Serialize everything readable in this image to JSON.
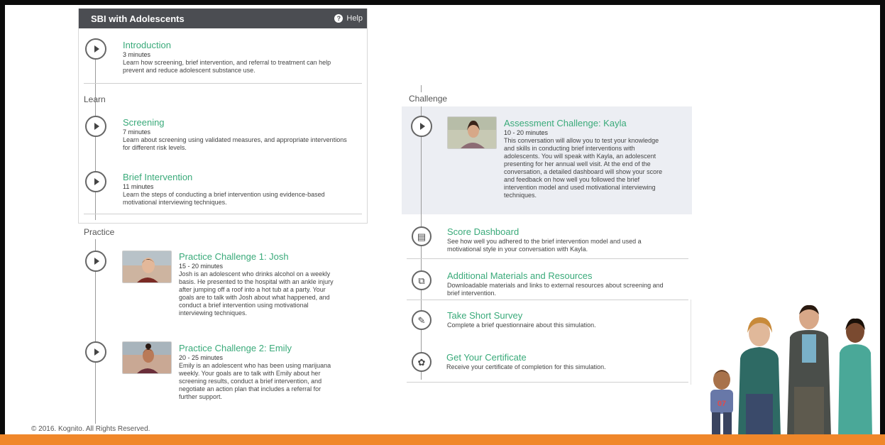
{
  "header": {
    "title": "SBI with Adolescents",
    "help": "Help"
  },
  "sections": {
    "learn": "Learn",
    "practice": "Practice",
    "challenge": "Challenge"
  },
  "intro": {
    "title": "Introduction",
    "duration": "3 minutes",
    "desc": [
      "Learn how screening, brief intervention, and referral to treatment can help",
      "prevent and reduce adolescent substance use."
    ]
  },
  "screening": {
    "title": "Screening",
    "duration": "7 minutes",
    "desc": [
      "Learn about screening using validated measures, and appropriate interventions",
      "for different risk levels."
    ]
  },
  "brief": {
    "title": "Brief Intervention",
    "duration": "11 minutes",
    "desc": [
      "Learn the steps of conducting a brief intervention using evidence-based",
      "motivational interviewing techniques."
    ]
  },
  "josh": {
    "title": "Practice Challenge 1: Josh",
    "duration": "15 - 20 minutes",
    "desc": [
      "Josh is an adolescent who drinks alcohol on a weekly",
      "basis. He presented to the hospital with an ankle injury",
      "after jumping off a roof into a hot tub at a party. Your",
      "goals are to talk with Josh about what happened, and",
      "conduct a brief intervention using motivational",
      "interviewing techniques."
    ]
  },
  "emily": {
    "title": "Practice Challenge 2: Emily",
    "duration": "20 - 25 minutes",
    "desc": [
      "Emily is an adolescent who has been using marijuana",
      "weekly. Your goals are to talk with Emily about her",
      "screening results, conduct a brief intervention, and",
      "negotiate an action plan that includes a referral for",
      "further support."
    ]
  },
  "kayla": {
    "title": "Assessment Challenge: Kayla",
    "duration": "10 - 20 minutes",
    "desc": [
      "This conversation will allow you to test your knowledge",
      "and skills in conducting brief interventions with",
      "adolescents. You will speak with Kayla, an adolescent",
      "presenting for her annual well visit. At the end of the",
      "conversation, a detailed dashboard will show your score",
      "and feedback on how well you followed the brief",
      "intervention model and used motivational interviewing",
      "techniques."
    ]
  },
  "score": {
    "title": "Score Dashboard",
    "desc": [
      "See how well you adhered to the brief intervention model and used a",
      "motivational style in your conversation with Kayla."
    ]
  },
  "materials": {
    "title": "Additional Materials and Resources",
    "desc": [
      "Downloadable materials and links to external resources about screening and",
      "brief intervention."
    ]
  },
  "survey": {
    "title": "Take Short Survey",
    "desc": [
      "Complete a brief questionnaire about this simulation."
    ]
  },
  "certificate": {
    "title": "Get Your Certificate",
    "desc": [
      "Receive your certificate of completion for this simulation."
    ]
  },
  "footer": {
    "copyright": "© 2016. Kognito. All Rights Reserved.",
    "jersey": "07"
  },
  "colors": {
    "accent": "#3aaa7a",
    "header_bg": "#4b4d52",
    "bottom_bar": "#f0872a",
    "highlight_bg": "#eceef3"
  }
}
